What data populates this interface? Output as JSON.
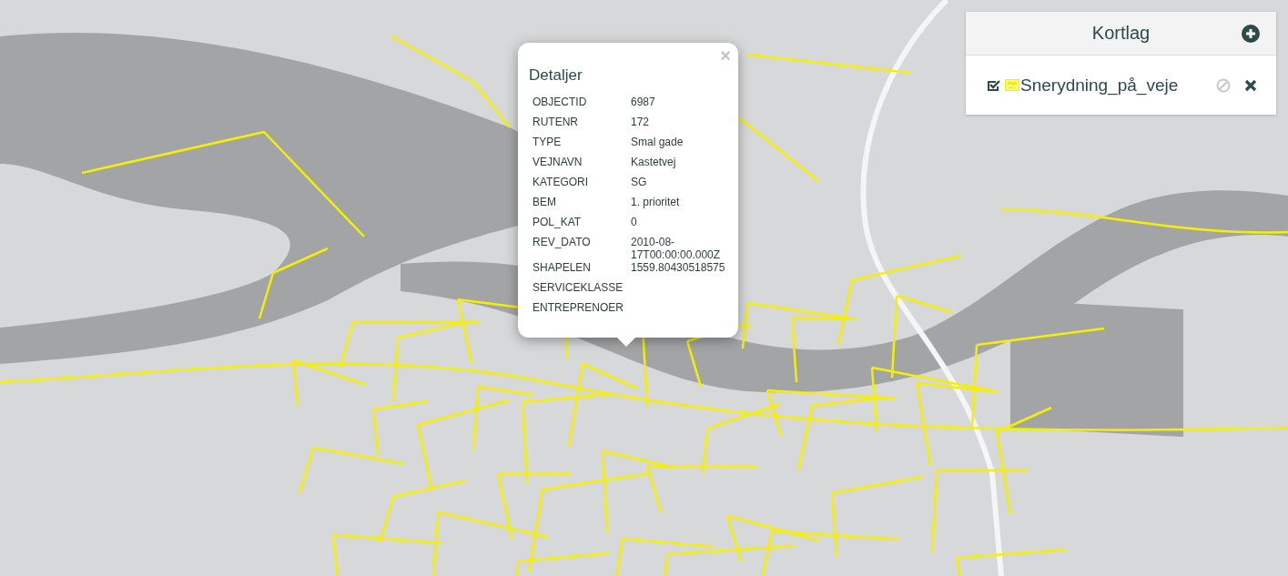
{
  "popup": {
    "title": "Detaljer",
    "close": "×",
    "fields": [
      {
        "label": "OBJECTID",
        "value": "6987"
      },
      {
        "label": "RUTENR",
        "value": "172"
      },
      {
        "label": "TYPE",
        "value": "Smal gade"
      },
      {
        "label": "VEJNAVN",
        "value": "Kastetvej"
      },
      {
        "label": "KATEGORI",
        "value": "SG"
      },
      {
        "label": "BEM",
        "value": "1. prioritet"
      },
      {
        "label": "POL_KAT",
        "value": "0"
      },
      {
        "label": "REV_DATO",
        "value": "2010-08-17T00:00:00.000Z"
      },
      {
        "label": "SHAPELEN",
        "value": "1559.80430518575"
      },
      {
        "label": "SERVICEKLASSE"
      },
      {
        "label": "ENTREPRENOER"
      }
    ]
  },
  "layer_panel": {
    "title": "Kortlag",
    "layers": [
      {
        "name": "Snerydning_på_veje",
        "checked": true
      }
    ]
  }
}
